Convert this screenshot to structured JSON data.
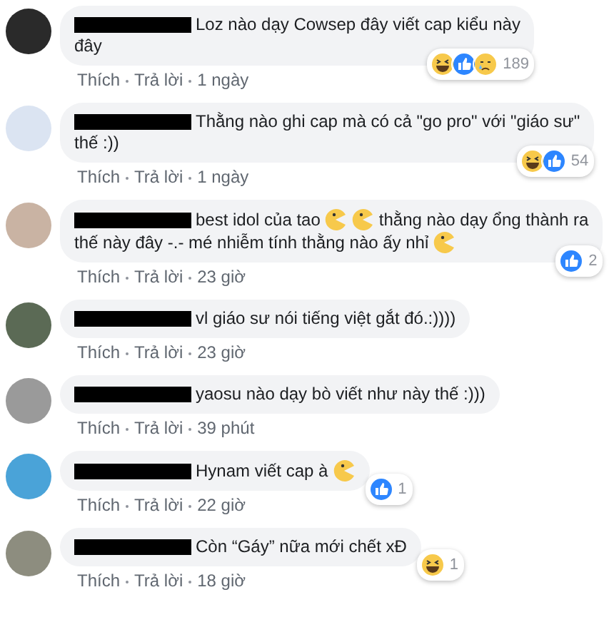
{
  "comments": [
    {
      "lines": [
        [
          {
            "kind": "text",
            "text": "Loz nào dạy Cowsep đây viết cap kiểu này"
          }
        ],
        [
          {
            "kind": "text",
            "text": "đây"
          }
        ]
      ],
      "reactions": [
        {
          "kind": "haha"
        },
        {
          "kind": "like"
        },
        {
          "kind": "sad"
        }
      ],
      "reaction_count": "189",
      "actions": {
        "like": "Thích",
        "reply": "Trả lời",
        "time": "1 ngày"
      }
    },
    {
      "lines": [
        [
          {
            "kind": "text",
            "text": "Thằng nào ghi cap mà có cả \"go pro\" với \"giáo sư\""
          }
        ],
        [
          {
            "kind": "text",
            "text": "thế :))"
          }
        ]
      ],
      "reactions": [
        {
          "kind": "haha"
        },
        {
          "kind": "like"
        }
      ],
      "reaction_count": "54",
      "actions": {
        "like": "Thích",
        "reply": "Trả lời",
        "time": "1 ngày"
      }
    },
    {
      "lines": [
        [
          {
            "kind": "text",
            "text": "best idol của tao"
          },
          {
            "kind": "emoji"
          },
          {
            "kind": "emoji"
          },
          {
            "kind": "text",
            "text": "thằng nào dạy ổng thành ra"
          }
        ],
        [
          {
            "kind": "text",
            "text": "thế này đây -.- mé nhiễm tính thằng nào ấy nhỉ"
          },
          {
            "kind": "emoji"
          }
        ]
      ],
      "reactions": [
        {
          "kind": "like"
        }
      ],
      "reaction_count": "2",
      "actions": {
        "like": "Thích",
        "reply": "Trả lời",
        "time": "23 giờ"
      }
    },
    {
      "lines": [
        [
          {
            "kind": "text",
            "text": "vl giáo sư nói tiếng việt gắt đó.:))))"
          }
        ]
      ],
      "actions": {
        "like": "Thích",
        "reply": "Trả lời",
        "time": "23 giờ"
      }
    },
    {
      "lines": [
        [
          {
            "kind": "text",
            "text": "yaosu nào dạy bò viết như này thế :)))"
          }
        ]
      ],
      "actions": {
        "like": "Thích",
        "reply": "Trả lời",
        "time": "39 phút"
      }
    },
    {
      "lines": [
        [
          {
            "kind": "text",
            "text": "Hynam viết cap à"
          },
          {
            "kind": "emoji"
          }
        ]
      ],
      "reactions": [
        {
          "kind": "like"
        }
      ],
      "reaction_count": "1",
      "actions": {
        "like": "Thích",
        "reply": "Trả lời",
        "time": "22 giờ"
      }
    },
    {
      "lines": [
        [
          {
            "kind": "text",
            "text": "Còn “Gáy” nữa mới chết xĐ"
          }
        ]
      ],
      "reactions": [
        {
          "kind": "haha"
        }
      ],
      "reaction_count": "1",
      "actions": {
        "like": "Thích",
        "reply": "Trả lời",
        "time": "18 giờ"
      }
    }
  ]
}
